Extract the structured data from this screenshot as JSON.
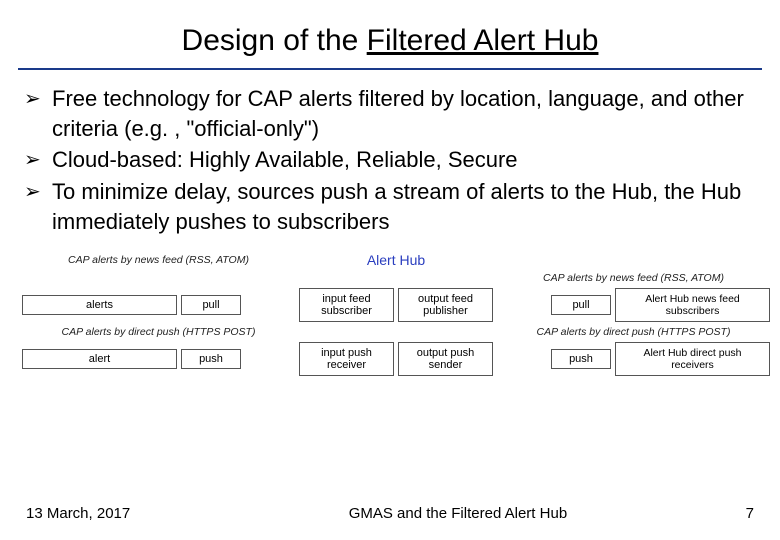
{
  "title_prefix": "Design of the ",
  "title_underlined": "Filtered Alert Hub",
  "bullets": [
    "Free technology for CAP alerts filtered by location, language, and other criteria (e.g. , \"official‑only\")",
    "Cloud-based: Highly Available, Reliable, Secure",
    "To minimize delay, sources push a stream of alerts to the Hub, the Hub immediately pushes to subscribers"
  ],
  "diagram": {
    "hub_title": "Alert Hub",
    "left_feed_label": "CAP alerts by news feed (RSS, ATOM)",
    "left_alerts_box": "alerts",
    "left_pull_box": "pull",
    "left_push_label": "CAP alerts by direct push (HTTPS POST)",
    "left_alert_box": "alert",
    "left_push_box": "push",
    "input_feed_box": "input feed subscriber",
    "input_push_box": "input push receiver",
    "output_feed_box": "output feed publisher",
    "output_push_box": "output push sender",
    "right_feed_label": "CAP alerts by news feed (RSS, ATOM)",
    "right_pull_box": "pull",
    "right_news_box": "Alert Hub news feed subscribers",
    "right_push_label": "CAP alerts by direct push (HTTPS POST)",
    "right_push_box": "push",
    "right_direct_box": "Alert Hub direct push receivers"
  },
  "footer": {
    "date": "13 March, 2017",
    "title": "GMAS and the Filtered Alert Hub",
    "page": "7"
  }
}
